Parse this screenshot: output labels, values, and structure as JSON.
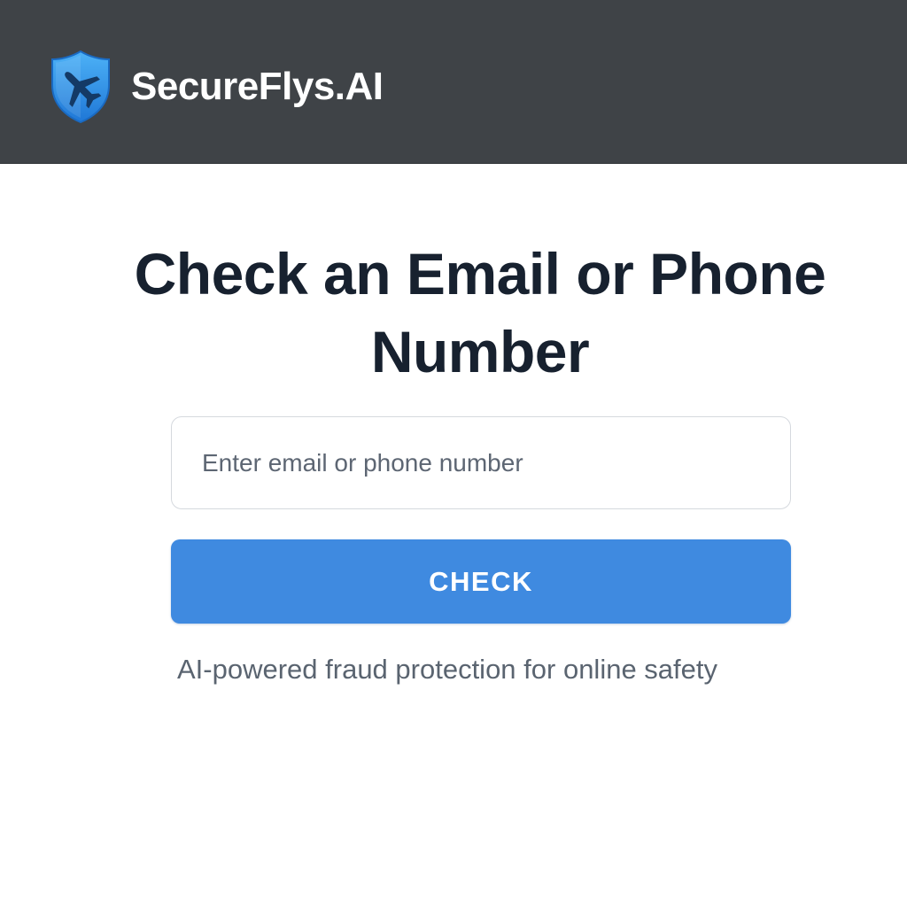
{
  "header": {
    "brand_name": "SecureFlys.AI",
    "logo_icon": "shield-airplane-icon",
    "background_color": "#3f4347"
  },
  "main": {
    "title": "Check an Email or Phone Number",
    "input": {
      "value": "",
      "placeholder": "Enter email or phone number"
    },
    "check_button_label": "CHECK",
    "tagline": "AI-powered fraud protection for online safety"
  },
  "colors": {
    "accent": "#3f8ae0",
    "title_text": "#17212f",
    "muted_text": "#5a6470"
  }
}
